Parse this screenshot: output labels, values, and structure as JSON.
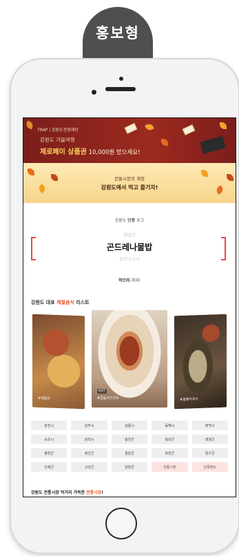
{
  "badge": {
    "label": "홍보형"
  },
  "banner_top": {
    "small_text": "TRAP | 강원도관광재단",
    "line1": "강원도 가을여행",
    "line2_highlight": "제로페이 상품권",
    "line2_rest": " 10,000원 받으세요!"
  },
  "banner_second": {
    "line1": "전통시장의 계절",
    "line2": "강원도에서 먹고 즐기자!"
  },
  "intro": {
    "prefix": "강원도 ",
    "bold": "단풍",
    "suffix": " 보고"
  },
  "dish": {
    "prev": "메밀전",
    "current": "곤드레나물밥",
    "next": "올챙이국수"
  },
  "eat_line": {
    "bold": "먹으러",
    "suffix": " 가자!"
  },
  "section": {
    "title_prefix": "강원도 대표 ",
    "title_highlight": "제철음식",
    "title_suffix": " 리스트"
  },
  "photos": [
    {
      "tag": "#메밀전",
      "badge": ""
    },
    {
      "tag": "#콧등치기국수",
      "badge": "HOT"
    },
    {
      "tag": "#올챙이국수",
      "badge": ""
    }
  ],
  "regions": [
    "춘천시",
    "원주시",
    "강릉시",
    "동해시",
    "태백시",
    "속초시",
    "삼척시",
    "홍천군",
    "횡성군",
    "영월군",
    "평창군",
    "정선군",
    "철원군",
    "화천군",
    "양구군",
    "인제군",
    "고성군",
    "양양군",
    "전통시장",
    "단풍명소"
  ],
  "bottom_line": {
    "prefix": "강원도 전통시장 먹거리 가득한 ",
    "highlight": "전통시장",
    "suffix": "!"
  },
  "colors": {
    "accent": "#e64a4a",
    "badge_bg": "#4f4f4f",
    "highlight": "#e05a2b"
  }
}
